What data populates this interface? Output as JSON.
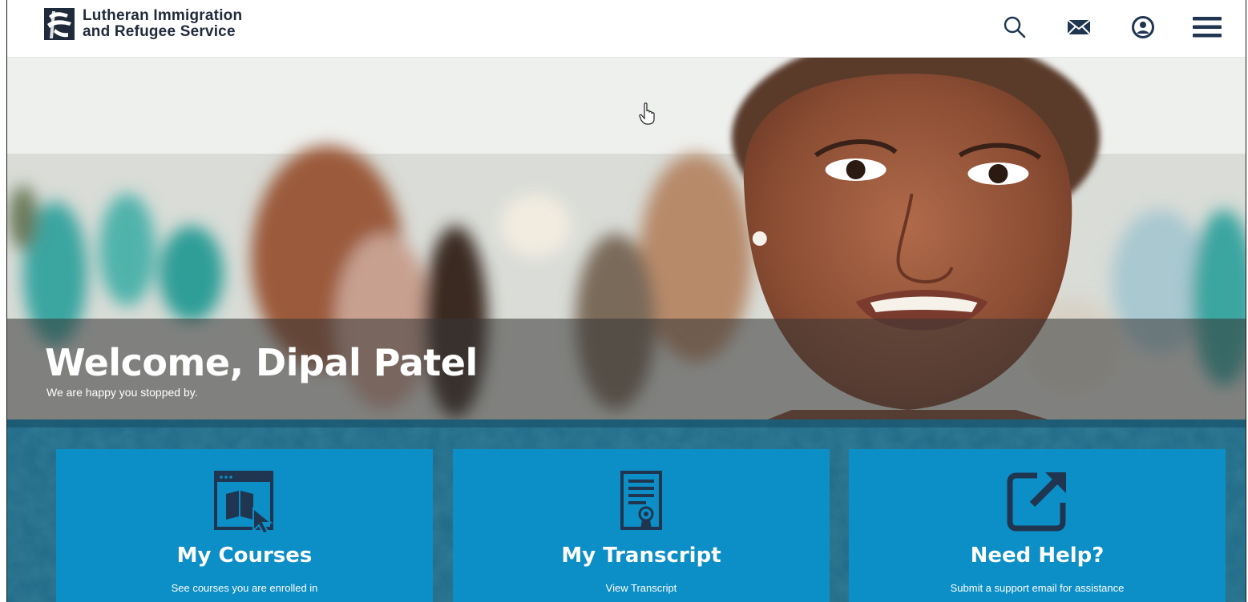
{
  "header": {
    "org_line1": "Lutheran Immigration",
    "org_line2": "and Refugee Service",
    "icons": [
      "search-icon",
      "mail-icon",
      "user-profile-icon",
      "menu-icon"
    ]
  },
  "hero": {
    "title": "Welcome, Dipal Patel",
    "subtitle": "We are happy you stopped by."
  },
  "tiles": [
    {
      "title": "My Courses",
      "description": "See courses you are enrolled in",
      "icon": "courses-icon"
    },
    {
      "title": "My Transcript",
      "description": "View Transcript",
      "icon": "transcript-icon"
    },
    {
      "title": "Need Help?",
      "description": "Submit a support email for assistance",
      "icon": "external-link-icon"
    }
  ],
  "colors": {
    "brand_dark": "#1f2a3a",
    "tile_blue": "#0c8ec6",
    "section_bg": "#1d5d79",
    "icon_dark": "#1f3550"
  }
}
